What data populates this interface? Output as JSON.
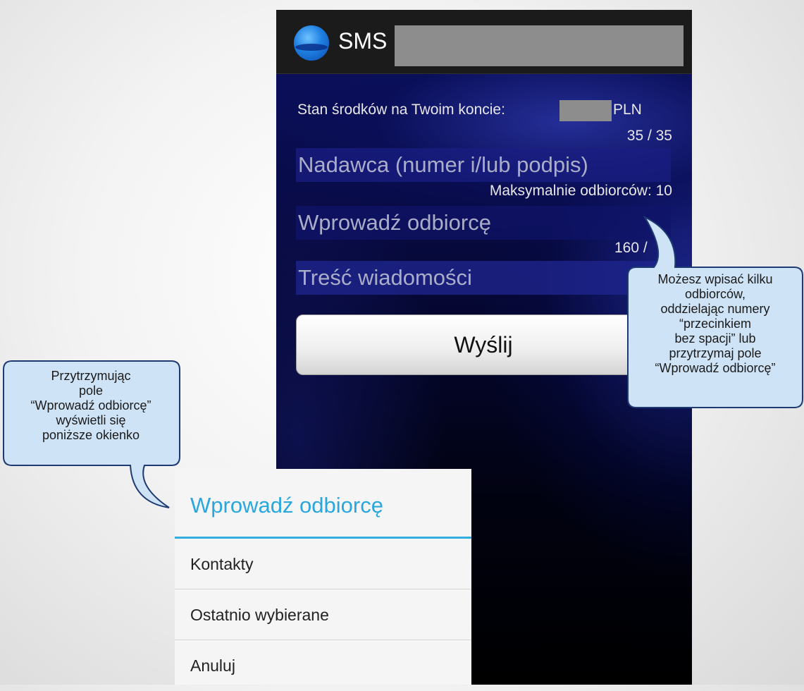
{
  "app": {
    "title": "SMS"
  },
  "form": {
    "balance_label": "Stan środków na Twoim koncie:",
    "balance_currency": "PLN",
    "sender_counter": "35 / 35",
    "sender_placeholder": "Nadawca (numer i/lub podpis)",
    "max_recipients": "Maksymalnie odbiorców: 10",
    "recipient_placeholder": "Wprowadź odbiorcę",
    "message_counter": "160 /",
    "message_placeholder": "Treść wiadomości",
    "send_label": "Wyślij"
  },
  "dialog": {
    "title": "Wprowadź odbiorcę",
    "items": [
      "Kontakty",
      "Ostatnio wybierane",
      "Anuluj"
    ]
  },
  "callouts": {
    "left": [
      "Przytrzymując",
      "pole",
      "“Wprowadź odbiorcę”",
      "wyświetli się",
      "poniższe okienko"
    ],
    "right": [
      "Możesz wpisać kilku",
      "odbiorców,",
      "oddzielając numery",
      "“przecinkiem",
      "bez spacji” lub",
      "przytrzymaj pole",
      "“Wprowadź odbiorcę”"
    ]
  },
  "colors": {
    "accent": "#33aee0",
    "callout_fill": "#cfe3f6",
    "callout_border": "#1d3a73"
  }
}
